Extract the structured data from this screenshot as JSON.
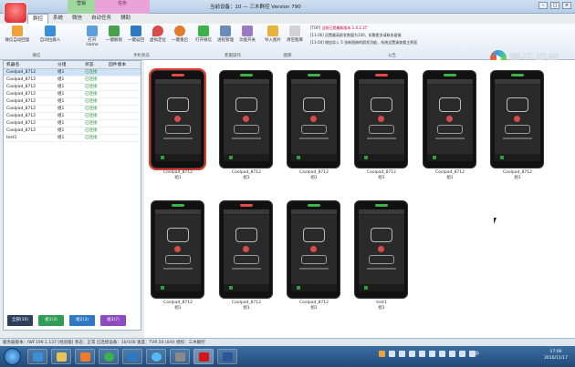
{
  "titlebar": {
    "window_title": "当前设备：10 — 三木群控 Version 790",
    "context_tabs": [
      "营销",
      "任务"
    ],
    "menu_tabs": [
      "群控",
      "系统",
      "微信",
      "自动任务",
      "辅助"
    ]
  },
  "ribbon": {
    "group_device": {
      "label": "微信",
      "buttons": [
        "微信自动回复",
        "自动拉群人"
      ]
    },
    "group_phone": {
      "label": "手机状态",
      "buttons": [
        "打开Home",
        "一键解锁",
        "一键返回",
        "虚拟定位",
        "一键重启"
      ]
    },
    "group_wechat": {
      "label": "客服操作",
      "buttons": [
        "打开微信",
        "进程管理",
        "功能开关"
      ]
    },
    "group_album": {
      "label": "图库",
      "buttons": [
        "导入图片",
        "清空图库"
      ]
    },
    "notice_label": "公告",
    "notices": [
      {
        "prefix": "[TOP]",
        "text": "当前已是最新版本 1.0.2.37"
      },
      {
        "prefix": "[11-06]",
        "text": "设置最高群发数量为100，如需更多请联系客服"
      },
      {
        "prefix": "[11-04]",
        "text": "增加导入 5 张新图做的群发功能，系统设置请查看主界面"
      }
    ],
    "brand_text": "腾讯视频"
  },
  "device_table": {
    "columns": [
      "机器名",
      "分组",
      "状态",
      "固件版本"
    ],
    "rows": [
      {
        "name": "Coolpad_8712",
        "group": "组1",
        "status": "已连接",
        "fw": ""
      },
      {
        "name": "Coolpad_8712",
        "group": "组1",
        "status": "已连接",
        "fw": ""
      },
      {
        "name": "Coolpad_8712",
        "group": "组1",
        "status": "已连接",
        "fw": ""
      },
      {
        "name": "Coolpad_8712",
        "group": "组1",
        "status": "已连接",
        "fw": ""
      },
      {
        "name": "Coolpad_8712",
        "group": "组1",
        "status": "已连接",
        "fw": ""
      },
      {
        "name": "Coolpad_8712",
        "group": "组1",
        "status": "已连接",
        "fw": ""
      },
      {
        "name": "Coolpad_8712",
        "group": "组1",
        "status": "已连接",
        "fw": ""
      },
      {
        "name": "Coolpad_8712",
        "group": "组1",
        "status": "已连接",
        "fw": ""
      },
      {
        "name": "Coolpad_8712",
        "group": "组1",
        "status": "已连接",
        "fw": ""
      },
      {
        "name": "test1",
        "group": "组1",
        "status": "已连接",
        "fw": ""
      }
    ]
  },
  "group_buttons": [
    {
      "label": "全部(10)",
      "color": "#2d3f5c"
    },
    {
      "label": "组1(3)",
      "color": "#2f9d57"
    },
    {
      "label": "组2(3)",
      "color": "#2f78c4"
    },
    {
      "label": "组3(7)",
      "color": "#8d4bbf"
    }
  ],
  "phones": [
    {
      "label": "Coolpad_8712",
      "group": "组1",
      "led": "#e34b4b",
      "selected": true
    },
    {
      "label": "Coolpad_8712",
      "group": "组1",
      "led": "#3bb34a",
      "selected": false
    },
    {
      "label": "Coolpad_8712",
      "group": "组1",
      "led": "#3bb34a",
      "selected": false
    },
    {
      "label": "Coolpad_8712",
      "group": "组1",
      "led": "#e34b4b",
      "selected": false
    },
    {
      "label": "Coolpad_8712",
      "group": "组1",
      "led": "#3bb34a",
      "selected": false
    },
    {
      "label": "Coolpad_8712",
      "group": "组1",
      "led": "#3bb34a",
      "selected": false
    },
    {
      "label": "Coolpad_8712",
      "group": "组1",
      "led": "#3bb34a",
      "selected": false
    },
    {
      "label": "Coolpad_8712",
      "group": "组1",
      "led": "#e34b4b",
      "selected": false
    },
    {
      "label": "Coolpad_8712",
      "group": "组1",
      "led": "#3bb34a",
      "selected": false
    },
    {
      "label": "test1",
      "group": "组1",
      "led": "#3bb34a",
      "selected": false
    }
  ],
  "statusbar": {
    "text": "服务器版本：IWF.199.1.137 [经验版]   状态：正常   已连接设备：10/100   速度：TVR.50 (0/0)   授权：三木群控"
  },
  "taskbar": {
    "lang": "中",
    "time": "17:06",
    "date": "2016/11/17"
  }
}
